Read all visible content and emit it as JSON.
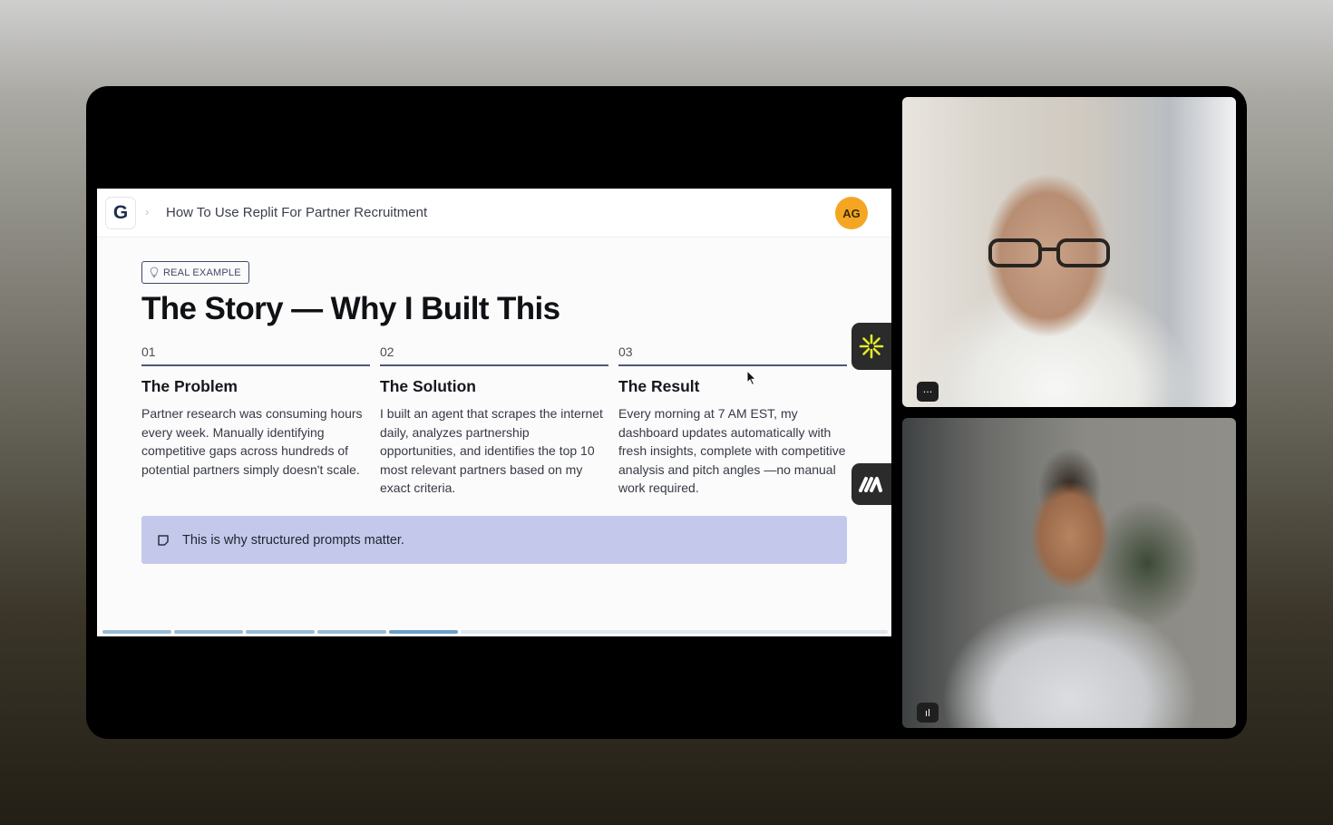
{
  "slide": {
    "logo_letter": "G",
    "breadcrumb_sep": "›",
    "deck_title": "How To Use Replit For Partner Recruitment",
    "avatar_initials": "AG",
    "tag_label": "REAL EXAMPLE",
    "title": "The Story — Why I Built This",
    "columns": [
      {
        "number": "01",
        "heading": "The Problem",
        "body": "Partner research was consuming hours every week. Manually identifying competitive gaps across hundreds of potential partners simply doesn't scale."
      },
      {
        "number": "02",
        "heading": "The Solution",
        "body": "I built an agent that scrapes the internet daily, analyzes partnership opportunities, and identifies the top 10 most relevant partners based on my exact criteria."
      },
      {
        "number": "03",
        "heading": "The Result",
        "body": "Every morning at 7 AM EST, my dashboard updates automatically with fresh insights, complete with competitive analysis and pitch angles —no manual work required."
      }
    ],
    "callout_text": "This is why structured prompts matter.",
    "progress": {
      "segments_total": 5,
      "current_segment": 5
    }
  },
  "floating_buttons": [
    {
      "icon": "asterisk-burst-icon",
      "accent": "#e4ea2a"
    },
    {
      "icon": "m-logo-icon",
      "accent": "#ffffff"
    }
  ],
  "participants": [
    {
      "tile_icon": "more-dots-icon",
      "glyph": "···"
    },
    {
      "tile_icon": "audio-level-icon",
      "glyph": "ıl"
    }
  ],
  "colors": {
    "accent_navy": "#3f4a66",
    "callout_bg": "#c4c9eb",
    "avatar_bg": "#f4a623",
    "progress": "#6d9fc6"
  }
}
